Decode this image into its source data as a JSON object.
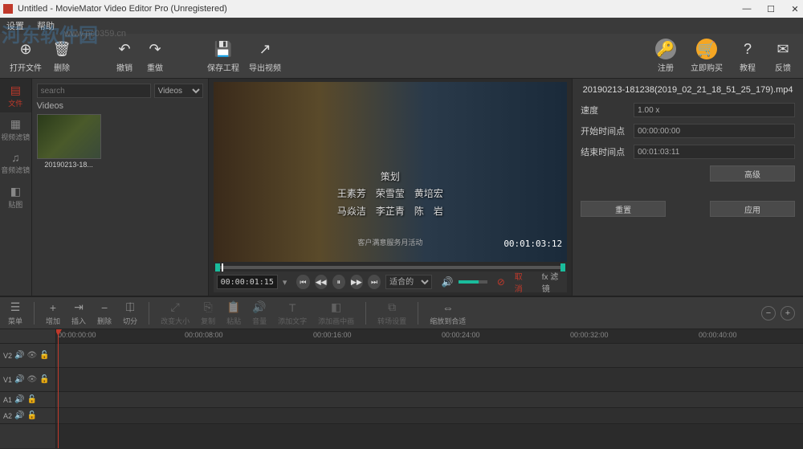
{
  "window": {
    "title": "Untitled - MovieMator Video Editor Pro (Unregistered)"
  },
  "menubar": {
    "items": [
      "设置",
      "帮助"
    ]
  },
  "watermark": {
    "main": "河东软件园",
    "sub": "www.pc0359.cn"
  },
  "toolbar": {
    "open": "打开文件",
    "delete": "删除",
    "undo": "撤销",
    "redo": "重做",
    "save": "保存工程",
    "export": "导出视频",
    "register": "注册",
    "buy": "立即购买",
    "tutorial": "教程",
    "feedback": "反馈"
  },
  "sidebar": {
    "file": "文件",
    "video_filter": "视频滤镜",
    "audio_filter": "音频滤镜",
    "sticker": "贴图"
  },
  "media": {
    "search_placeholder": "search",
    "category_select": "Videos",
    "section": "Videos",
    "thumb_label": "20190213-18..."
  },
  "preview": {
    "timecode": "00:00:01:15",
    "zoom_select": "适合的",
    "overlay_time": "00:01:03:12",
    "credits_title": "策划",
    "credits_line1": "王素芳　荣雪莹　黄培宏",
    "credits_line2": "马焱洁　李芷青　陈　岩",
    "footer_text": "客户满意服务月活动",
    "props_cancel": "取消",
    "fx_label": "fx 滤镜"
  },
  "props": {
    "title": "20190213-181238(2019_02_21_18_51_25_179).mp4",
    "speed_label": "速度",
    "speed_value": "1.00 x",
    "start_label": "开始时间点",
    "start_value": "00:00:00:00",
    "end_label": "结束时间点",
    "end_value": "00:01:03:11",
    "advanced": "高级",
    "reset": "重置",
    "apply": "应用"
  },
  "timeline_toolbar": {
    "menu": "菜单",
    "add": "增加",
    "insert": "插入",
    "remove": "删除",
    "split": "切分",
    "resize": "改变大小",
    "copy": "复制",
    "paste": "粘贴",
    "volume": "音量",
    "text": "添加文字",
    "pip": "添加画中画",
    "transition": "转场设置",
    "scale_fit": "缩放到合适"
  },
  "timeline": {
    "marks": [
      "00:00:00:00",
      "00:00:08:00",
      "00:00:16:00",
      "00:00:24:00",
      "00:00:32:00",
      "00:00:40:00"
    ],
    "tracks": {
      "v2": "V2",
      "v1": "V1",
      "a1": "A1",
      "a2": "A2"
    }
  }
}
